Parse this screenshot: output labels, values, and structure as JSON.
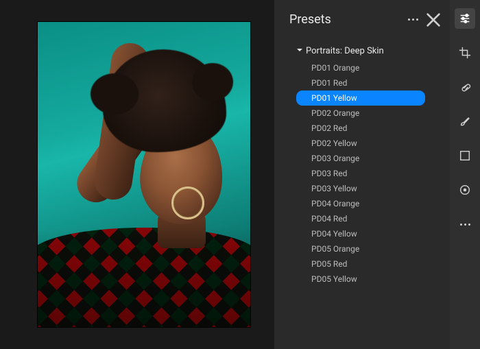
{
  "panel": {
    "title": "Presets",
    "group": {
      "label": "Portraits: Deep Skin",
      "expanded": true
    },
    "items": [
      {
        "label": "PD01 Orange",
        "selected": false
      },
      {
        "label": "PD01 Red",
        "selected": false
      },
      {
        "label": "PD01 Yellow",
        "selected": true
      },
      {
        "label": "PD02 Orange",
        "selected": false
      },
      {
        "label": "PD02 Red",
        "selected": false
      },
      {
        "label": "PD02 Yellow",
        "selected": false
      },
      {
        "label": "PD03 Orange",
        "selected": false
      },
      {
        "label": "PD03 Red",
        "selected": false
      },
      {
        "label": "PD03 Yellow",
        "selected": false
      },
      {
        "label": "PD04 Orange",
        "selected": false
      },
      {
        "label": "PD04 Red",
        "selected": false
      },
      {
        "label": "PD04 Yellow",
        "selected": false
      },
      {
        "label": "PD05 Orange",
        "selected": false
      },
      {
        "label": "PD05 Red",
        "selected": false
      },
      {
        "label": "PD05 Yellow",
        "selected": false
      }
    ]
  },
  "tools": [
    {
      "name": "edit-sliders-icon",
      "active": true
    },
    {
      "name": "crop-icon",
      "active": false
    },
    {
      "name": "healing-icon",
      "active": false
    },
    {
      "name": "brush-icon",
      "active": false
    },
    {
      "name": "linear-grad-icon",
      "active": false
    },
    {
      "name": "radial-grad-icon",
      "active": false
    },
    {
      "name": "more-icon",
      "active": false
    }
  ],
  "colors": {
    "accent": "#0a84ff",
    "panel_bg": "#2a2a2a",
    "app_bg": "#1a1a1a"
  }
}
